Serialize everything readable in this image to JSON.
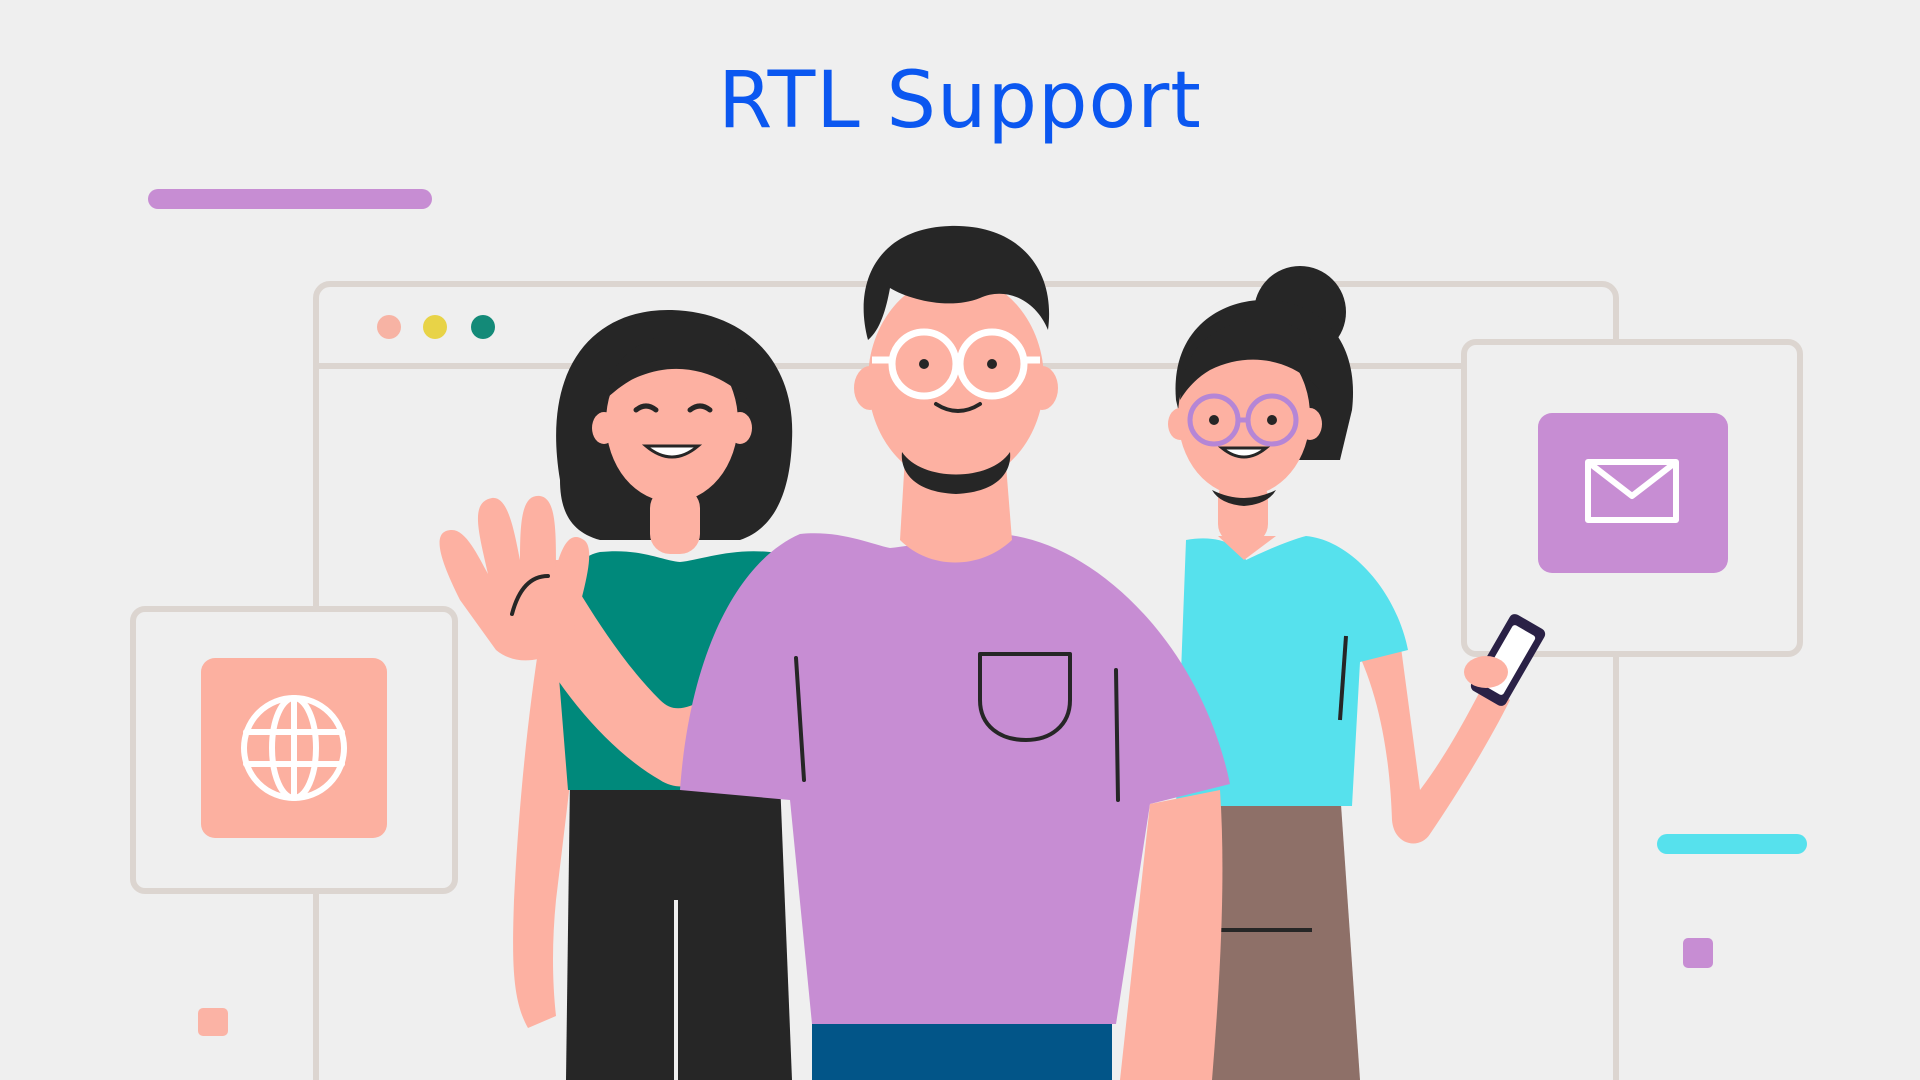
{
  "title": "RTL Support",
  "colors": {
    "background": "#efefef",
    "title": "#0b57f0",
    "purple": "#c78dd3",
    "teal": "#00897b",
    "cyan": "#56e1ed",
    "salmon": "#fcb0a0",
    "skin": "#fdb1a2",
    "hair": "#262626",
    "frame": "#dcd5d0",
    "dot_pink": "#f7b3a4",
    "dot_yellow": "#e8d347",
    "dot_teal": "#138a78",
    "pants_brown": "#8e7068",
    "jeans": "#025588"
  },
  "icons": {
    "globe": "globe-icon",
    "mail": "envelope-icon",
    "phone": "smartphone-icon"
  }
}
